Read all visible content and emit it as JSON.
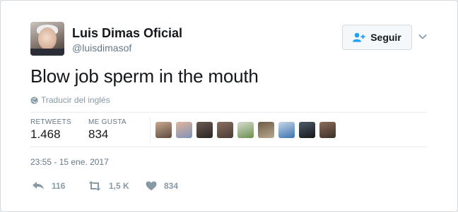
{
  "user": {
    "name": "Luis Dimas Oficial",
    "handle": "@luisdimasof"
  },
  "follow_button": {
    "label": "Seguir"
  },
  "tweet": {
    "text": "Blow job sperm in the mouth",
    "translate_label": "Traducir del inglés",
    "timestamp": "23:55 - 15 ene. 2017"
  },
  "stats": {
    "retweets_label": "RETWEETS",
    "retweets_value": "1.468",
    "likes_label": "ME GUSTA",
    "likes_value": "834"
  },
  "likers": [
    {
      "colors": [
        "#5b4a3f",
        "#c9a98f"
      ]
    },
    {
      "colors": [
        "#7e93b8",
        "#e0b59a"
      ]
    },
    {
      "colors": [
        "#2b2522",
        "#6a5a50"
      ]
    },
    {
      "colors": [
        "#4a3b33",
        "#8a6f60"
      ]
    },
    {
      "colors": [
        "#6b8f4e",
        "#d8dccf"
      ]
    },
    {
      "colors": [
        "#b9a98e",
        "#6e5a46"
      ]
    },
    {
      "colors": [
        "#3b73b0",
        "#c7d6e6"
      ]
    },
    {
      "colors": [
        "#15161a",
        "#4e5a6a"
      ]
    },
    {
      "colors": [
        "#3a2f29",
        "#8c6d58"
      ]
    }
  ],
  "actions": {
    "reply_count": "116",
    "retweet_count": "1,5 K",
    "like_count": "834"
  },
  "colors": {
    "text": "#14171a",
    "muted": "#657786",
    "icon": "#8899a6",
    "follow_icon": "#1da1f2"
  }
}
